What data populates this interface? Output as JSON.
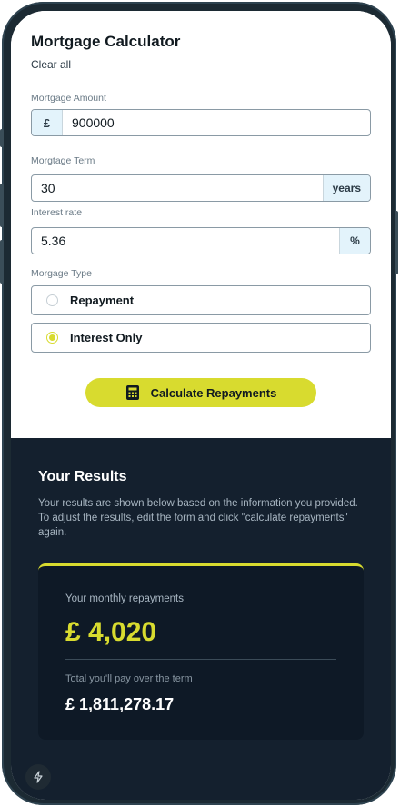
{
  "form": {
    "title": "Mortgage Calculator",
    "clear_label": "Clear all",
    "amount": {
      "label": "Mortgage Amount",
      "prefix": "£",
      "value": "900000"
    },
    "term": {
      "label": "Morgtage Term",
      "value": "30",
      "suffix": "years"
    },
    "rate": {
      "label": "Interest rate",
      "value": "5.36",
      "suffix": "%"
    },
    "type": {
      "label": "Morgage Type",
      "options": [
        {
          "label": "Repayment",
          "selected": false
        },
        {
          "label": "Interest Only",
          "selected": true
        }
      ]
    },
    "calculate_label": "Calculate Repayments",
    "calculate_icon": "calculator-icon"
  },
  "results": {
    "title": "Your Results",
    "description": "Your results are shown below based on the information you provided. To adjust the results, edit the form and click \"calculate repayments\" again.",
    "monthly_label": "Your monthly repayments",
    "monthly_value": "£ 4,020",
    "total_label": "Total you'll pay over the term",
    "total_value": "£ 1,811,278.17"
  },
  "colors": {
    "accent_lime": "#d8db2f",
    "results_bg": "#14202e",
    "input_addon_bg": "#e3f3fb"
  }
}
